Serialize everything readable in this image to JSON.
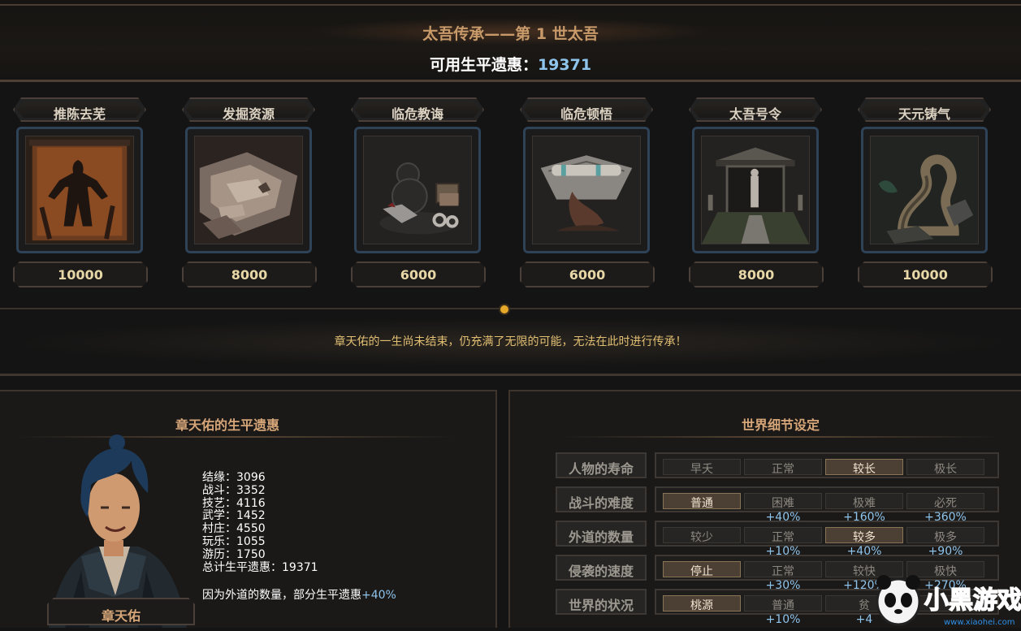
{
  "header": {
    "title": "太吾传承——第 1 世太吾",
    "points_label": "可用生平遗惠：",
    "points_value": "19371"
  },
  "cards": [
    {
      "label": "推陈去芜",
      "cost": "10000",
      "art": "figure-silhouette-scroll"
    },
    {
      "label": "发掘资源",
      "cost": "8000",
      "art": "papers-and-maps"
    },
    {
      "label": "临危教诲",
      "cost": "6000",
      "art": "gourd-and-boxes"
    },
    {
      "label": "临危顿悟",
      "cost": "6000",
      "art": "scroll-and-fan"
    },
    {
      "label": "太吾号令",
      "cost": "8000",
      "art": "shrine-gate"
    },
    {
      "label": "天元铸气",
      "cost": "10000",
      "art": "twisted-tree"
    }
  ],
  "notice": "章天佑的一生尚未结束，仍充满了无限的可能，无法在此时进行传承！",
  "legacy": {
    "title": "章天佑的生平遗惠",
    "name": "章天佑",
    "stats": [
      "结缘：3096",
      "战斗：3352",
      "技艺：4116",
      "武学：1452",
      "村庄：4550",
      "玩乐：1055",
      "游历：1750",
      "总计生平遗惠：19371"
    ],
    "bonus_text": "因为外道的数量，部分生平遗惠",
    "bonus_pct": "+40%"
  },
  "world": {
    "title": "世界细节设定",
    "rows": [
      {
        "label": "人物的寿命",
        "options": [
          {
            "text": "早夭",
            "sub": "",
            "selected": false
          },
          {
            "text": "正常",
            "sub": "",
            "selected": false
          },
          {
            "text": "较长",
            "sub": "",
            "selected": true
          },
          {
            "text": "极长",
            "sub": "",
            "selected": false
          }
        ]
      },
      {
        "label": "战斗的难度",
        "options": [
          {
            "text": "普通",
            "sub": "",
            "selected": true
          },
          {
            "text": "困难",
            "sub": "+40%",
            "selected": false
          },
          {
            "text": "极难",
            "sub": "+160%",
            "selected": false
          },
          {
            "text": "必死",
            "sub": "+360%",
            "selected": false
          }
        ]
      },
      {
        "label": "外道的数量",
        "options": [
          {
            "text": "较少",
            "sub": "",
            "selected": false
          },
          {
            "text": "正常",
            "sub": "+10%",
            "selected": false
          },
          {
            "text": "较多",
            "sub": "+40%",
            "selected": true
          },
          {
            "text": "极多",
            "sub": "+90%",
            "selected": false
          }
        ]
      },
      {
        "label": "侵袭的速度",
        "options": [
          {
            "text": "停止",
            "sub": "",
            "selected": true
          },
          {
            "text": "正常",
            "sub": "+30%",
            "selected": false
          },
          {
            "text": "较快",
            "sub": "+120%",
            "selected": false
          },
          {
            "text": "极快",
            "sub": "+270%",
            "selected": false
          }
        ]
      },
      {
        "label": "世界的状况",
        "options": [
          {
            "text": "桃源",
            "sub": "",
            "selected": true
          },
          {
            "text": "普通",
            "sub": "+10%",
            "selected": false
          },
          {
            "text": "贫",
            "sub": "+4",
            "selected": false
          },
          {
            "text": "",
            "sub": "",
            "selected": false
          }
        ]
      }
    ]
  },
  "watermark": {
    "text": "小黑游戏",
    "url_text": "www.xiaohei.com"
  },
  "colors": {
    "accent_gold": "#e1bf72",
    "bonus_blue": "#8fc4ec",
    "title_tan": "#d6a678"
  }
}
